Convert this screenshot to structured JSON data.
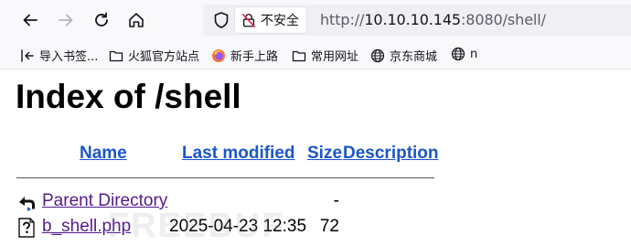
{
  "browser": {
    "security_label": "不安全",
    "url": {
      "scheme": "http://",
      "host": "10.10.10.145",
      "rest": ":8080/shell/"
    }
  },
  "bookmarks": [
    {
      "icon": "import-icon",
      "label": "导入书签..."
    },
    {
      "icon": "folder-icon",
      "label": "火狐官方站点"
    },
    {
      "icon": "firefox-icon",
      "label": "新手上路"
    },
    {
      "icon": "folder-icon",
      "label": "常用网址"
    },
    {
      "icon": "globe-icon",
      "label": "京东商城"
    },
    {
      "icon": "globe-icon",
      "label": "n"
    }
  ],
  "page": {
    "title": "Index of /shell",
    "columns": {
      "name": "Name",
      "last_modified": "Last modified",
      "size": "Size",
      "description": "Description"
    },
    "rows": [
      {
        "icon": "parent-directory-icon",
        "name": "Parent Directory",
        "last_modified": "",
        "size": "-",
        "description": ""
      },
      {
        "icon": "unknown-file-icon",
        "name": "b_shell.php",
        "last_modified": "2025-04-23 12:35",
        "size": "72",
        "description": ""
      }
    ]
  },
  "watermark": "FREEBUF",
  "colors": {
    "header_link": "#1a56c8",
    "visited_link": "#551a8b"
  }
}
